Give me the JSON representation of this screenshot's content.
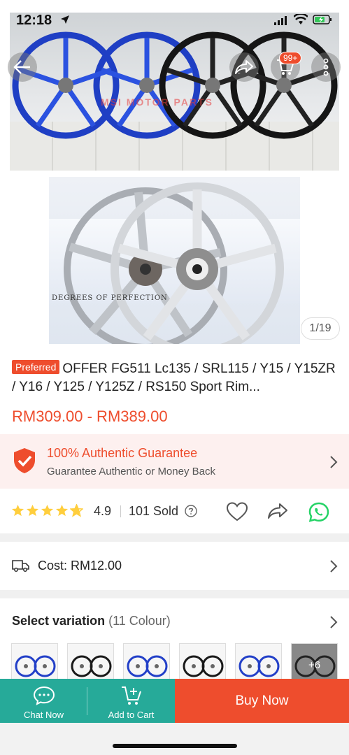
{
  "status_bar": {
    "time": "12:18"
  },
  "gallery": {
    "counter": "1/19",
    "cart_badge": "99+",
    "watermark": "MSI MOTOR PARTS",
    "box_text": "DEGREES OF PERFECTION"
  },
  "product": {
    "badge": "Preferred",
    "title": "OFFER FG511 Lc135 / SRL115 / Y15 / Y15ZR / Y16 / Y125 / Y125Z / RS150 Sport Rim...",
    "price": "RM309.00 - RM389.00"
  },
  "guarantee": {
    "title": "100% Authentic Guarantee",
    "subtitle": "Guarantee Authentic or Money Back"
  },
  "rating": {
    "value": "4.9",
    "stars": 4.9,
    "sold": "101 Sold"
  },
  "shipping": {
    "cost": "Cost: RM12.00"
  },
  "variation": {
    "title": "Select variation",
    "count": "(11 Colour)",
    "more": "+6",
    "thumbs": [
      {
        "rim": "blue"
      },
      {
        "rim": "black"
      },
      {
        "rim": "blue"
      },
      {
        "rim": "black"
      },
      {
        "rim": "blue"
      },
      {
        "rim": "black"
      }
    ]
  },
  "bottom_bar": {
    "chat_label": "Chat Now",
    "cart_label": "Add to Cart",
    "buy_label": "Buy Now"
  },
  "colors": {
    "accent": "#ee4d2d",
    "green": "#26aa99",
    "star": "#ffce3d",
    "whatsapp": "#25d366"
  }
}
